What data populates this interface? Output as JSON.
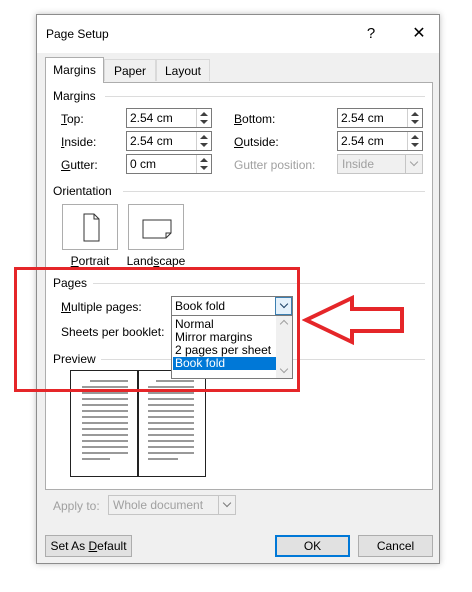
{
  "dialog": {
    "title": "Page Setup",
    "help_glyph": "?",
    "close_glyph": "✕"
  },
  "tabs": [
    {
      "label": "Margins",
      "active": true
    },
    {
      "label": "Paper",
      "active": false
    },
    {
      "label": "Layout",
      "active": false
    }
  ],
  "margins": {
    "section_label": "Margins",
    "top": {
      "label": "Top:",
      "key": "T",
      "rest": "op:",
      "value": "2.54 cm"
    },
    "bottom": {
      "label": "Bottom:",
      "key": "B",
      "rest": "ottom:",
      "value": "2.54 cm"
    },
    "inside": {
      "label": "Inside:",
      "key": "I",
      "rest": "nside:",
      "value": "2.54 cm"
    },
    "outside": {
      "label": "Outside:",
      "key": "O",
      "rest": "utside:",
      "value": "2.54 cm"
    },
    "gutter": {
      "label": "Gutter:",
      "key": "G",
      "rest": "utter:",
      "value": "0 cm"
    },
    "gutter_position": {
      "label": "Gutter position:",
      "value": "Inside"
    }
  },
  "orientation": {
    "section_label": "Orientation",
    "portrait": {
      "label": "Portrait",
      "key": "P",
      "rest": "ortrait"
    },
    "landscape": {
      "label": "Landscape",
      "pre": "Land",
      "key": "s",
      "rest": "cape"
    }
  },
  "pages": {
    "section_label": "Pages",
    "multiple_pages": {
      "label": "Multiple pages:",
      "key": "M",
      "rest": "ultiple pages:",
      "value": "Book fold"
    },
    "sheets_per_booklet": {
      "label": "Sheets per booklet:"
    },
    "options": [
      "Normal",
      "Mirror margins",
      "2 pages per sheet",
      "Book fold"
    ],
    "selected_option": "Book fold"
  },
  "preview": {
    "section_label": "Preview"
  },
  "apply_to": {
    "label": "Apply to:",
    "value": "Whole document"
  },
  "buttons": {
    "set_default": {
      "pre": "Set As ",
      "key": "D",
      "rest": "efault"
    },
    "ok": "OK",
    "cancel": "Cancel"
  },
  "colors": {
    "annotation_red": "#e52629",
    "selection_blue": "#0078d7"
  }
}
